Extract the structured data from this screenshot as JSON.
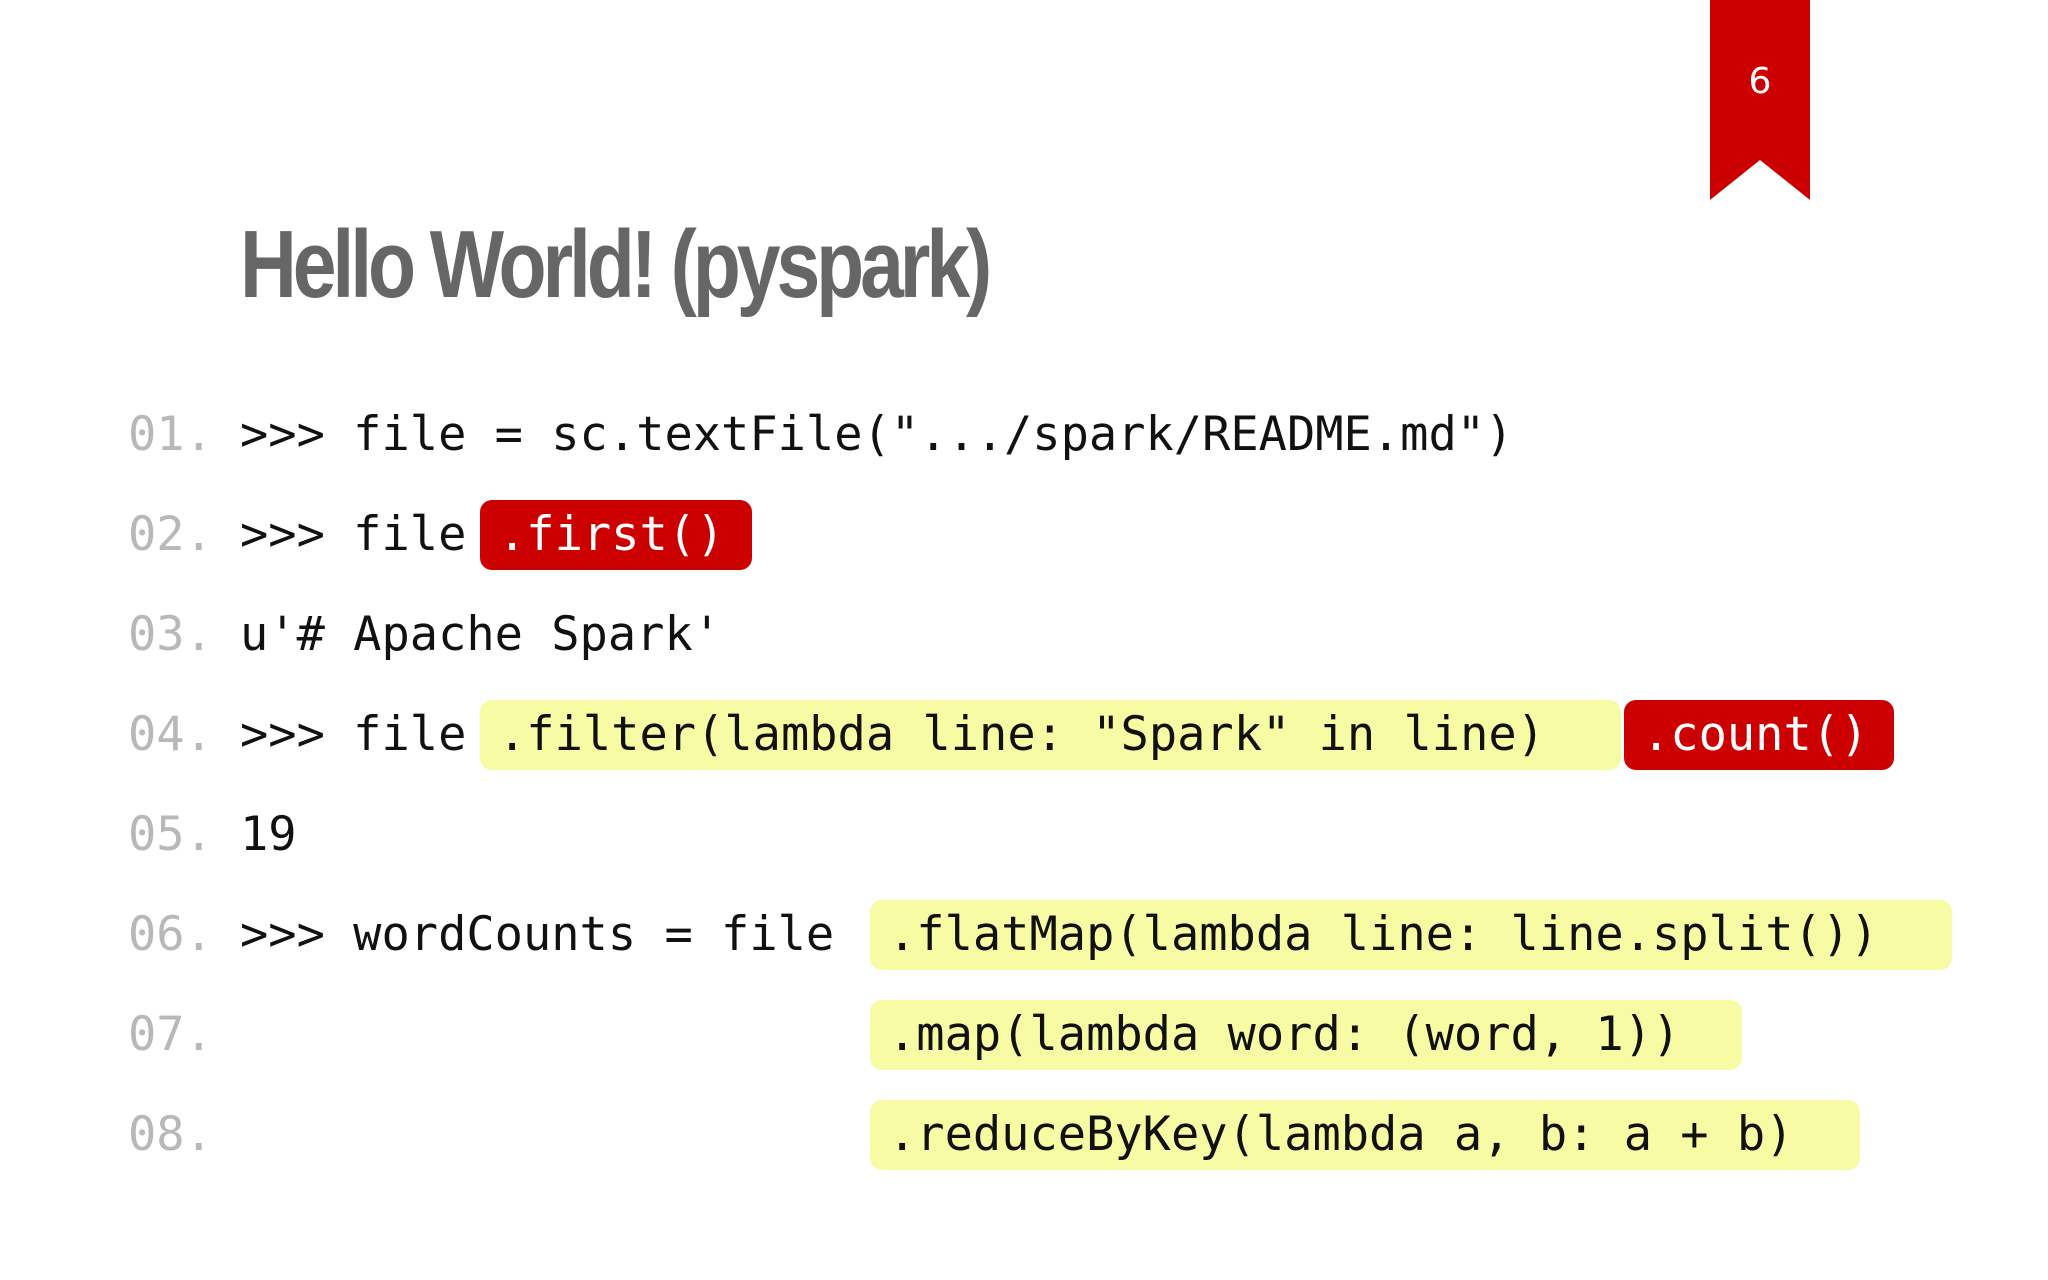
{
  "slide": {
    "page_number": "6",
    "title": "Hello World! (pyspark)"
  },
  "line_numbers": [
    "01.",
    "02.",
    "03.",
    "04.",
    "05.",
    "06.",
    "07.",
    "08."
  ],
  "code": {
    "line1": ">>> file = sc.textFile(\".../spark/README.md\")",
    "line2_prefix": ">>> file",
    "line2_call": ".first()",
    "line3": "u'# Apache Spark'",
    "line4_prefix": ">>> file",
    "line4_filter": ".filter(lambda line: \"Spark\" in line)",
    "line4_count": ".count()",
    "line5": "19",
    "line6_prefix": ">>> wordCounts = file",
    "line6_flatmap": ".flatMap(lambda line: line.split())",
    "line7_map": ".map(lambda word: (word, 1))",
    "line8_reduce": ".reduceByKey(lambda a, b: a + b)"
  },
  "colors": {
    "accent_red": "#cc0000",
    "highlight_yellow": "#f6fba4",
    "title_gray": "#666666",
    "line_number_gray": "#b8b8b8"
  }
}
